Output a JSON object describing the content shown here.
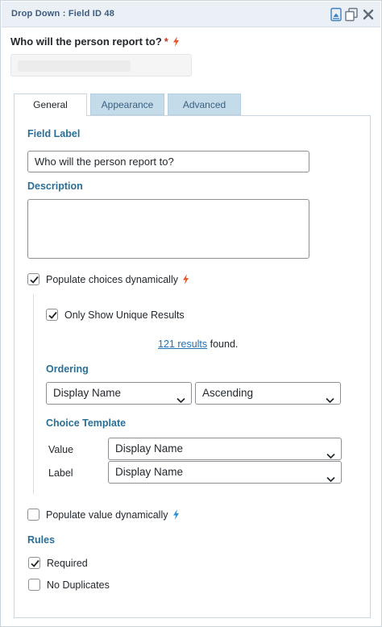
{
  "titlebar": {
    "title": "Drop Down : Field ID 48",
    "icons": [
      "field-widget-icon",
      "duplicate-field-icon",
      "close-icon"
    ]
  },
  "preview": {
    "question": "Who will the person report to?",
    "required_mark": "*"
  },
  "tabs": [
    {
      "label": "General",
      "active": true
    },
    {
      "label": "Appearance",
      "active": false
    },
    {
      "label": "Advanced",
      "active": false
    }
  ],
  "general": {
    "field_label_heading": "Field Label",
    "field_label_value": "Who will the person report to?",
    "description_heading": "Description",
    "description_value": "",
    "populate_choices": {
      "label": "Populate choices dynamically",
      "checked": true
    },
    "unique_results": {
      "label": "Only Show Unique Results",
      "checked": true
    },
    "results": {
      "count": "121 results",
      "suffix": " found."
    },
    "ordering": {
      "heading": "Ordering",
      "field": "Display Name",
      "direction": "Ascending"
    },
    "choice_template": {
      "heading": "Choice Template",
      "value_label": "Value",
      "value_field": "Display Name",
      "label_label": "Label",
      "label_field": "Display Name"
    },
    "populate_value": {
      "label": "Populate value dynamically",
      "checked": false
    },
    "rules": {
      "heading": "Rules",
      "required": {
        "label": "Required",
        "checked": true
      },
      "no_duplicates": {
        "label": "No Duplicates",
        "checked": false
      }
    }
  },
  "colors": {
    "accent": "#2a6f97",
    "bolt_orange": "#e4572e",
    "bolt_blue": "#2f8fd8",
    "tab_inactive": "#c4dbea",
    "link": "#2271b1"
  }
}
